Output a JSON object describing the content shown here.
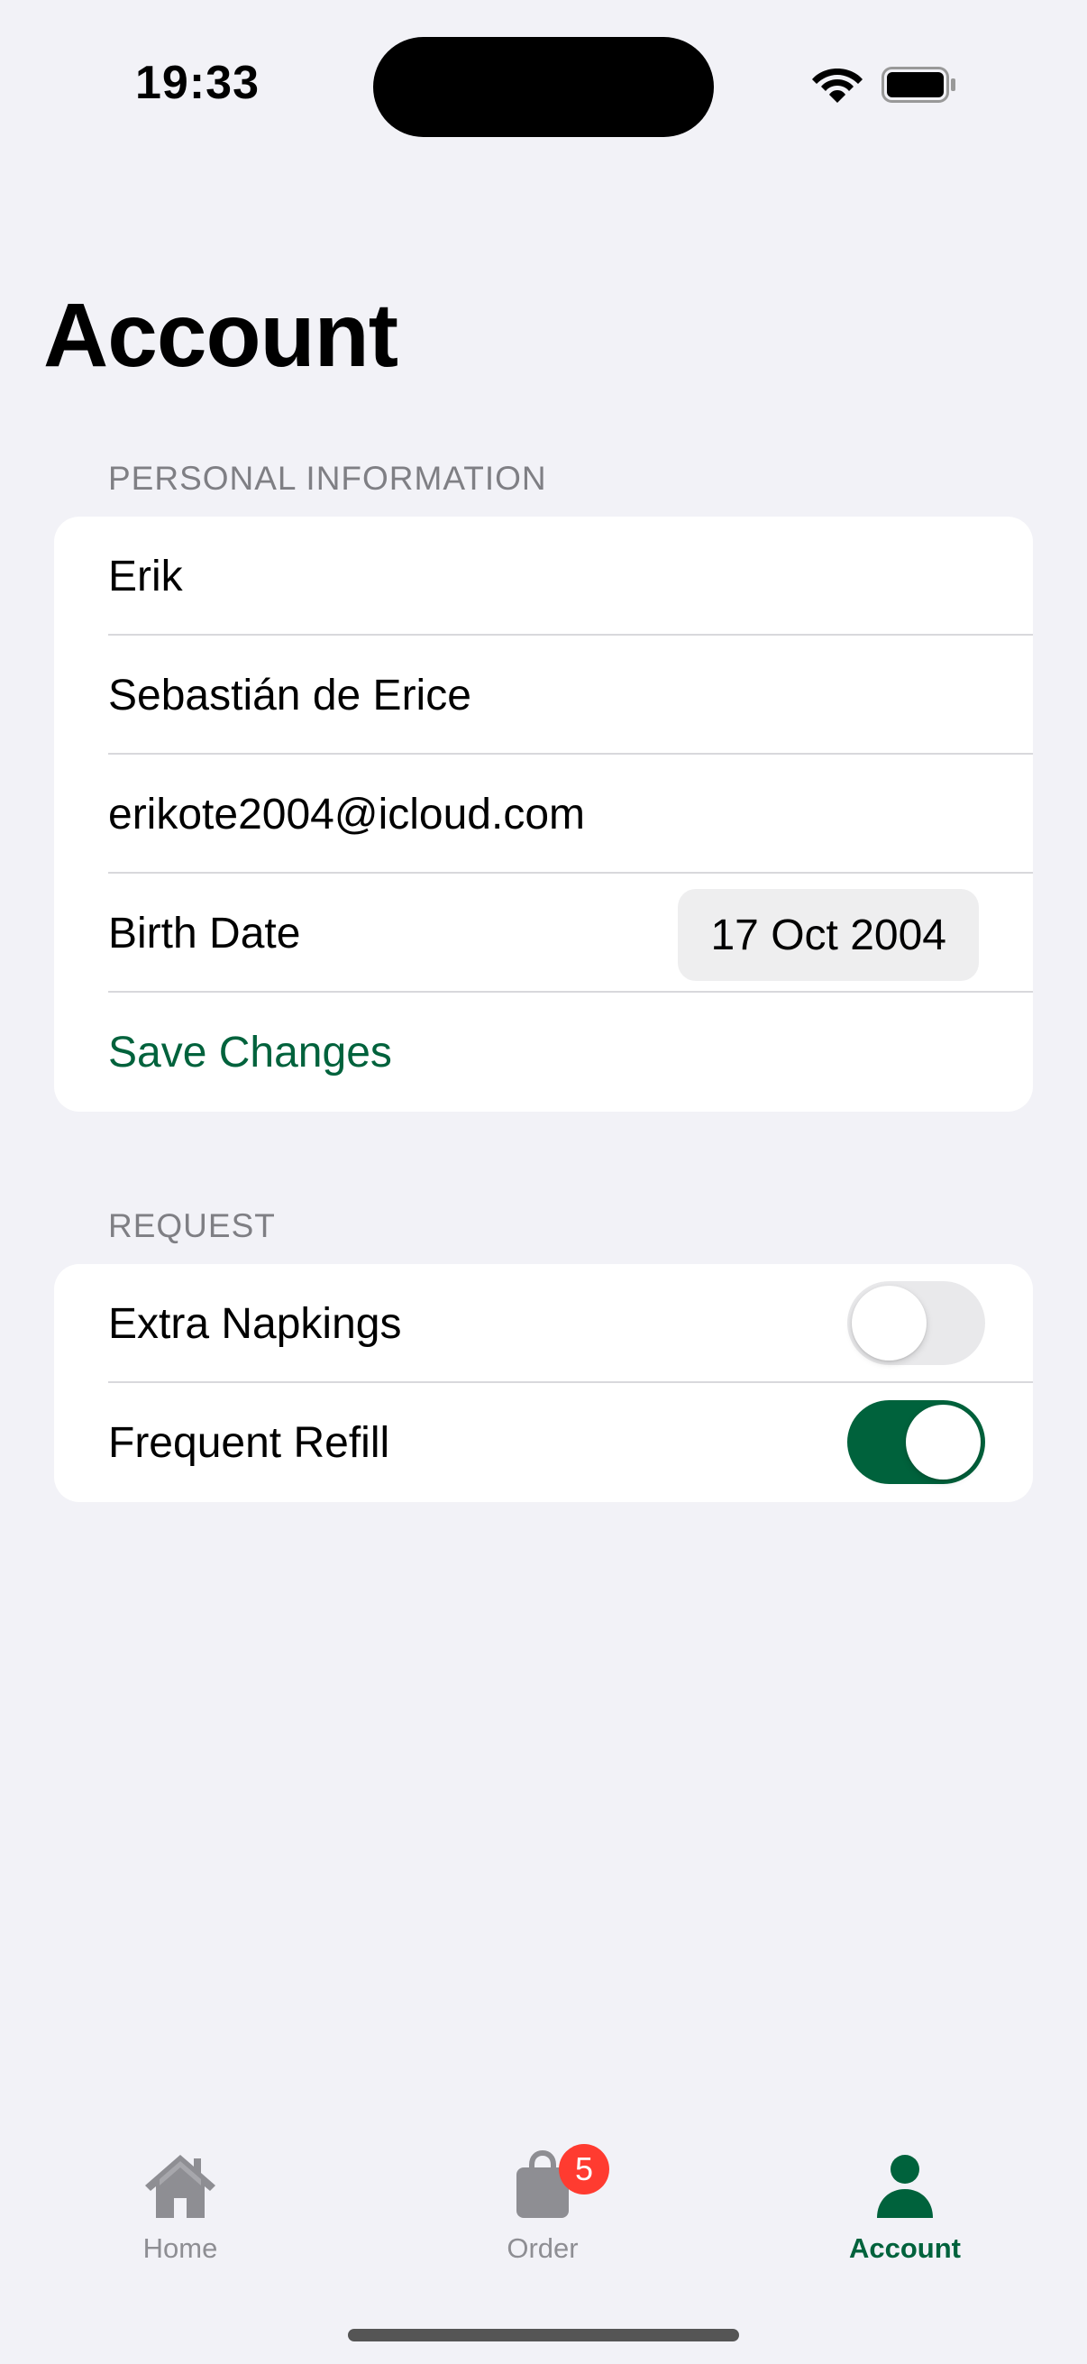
{
  "status_bar": {
    "time": "19:33"
  },
  "page": {
    "title": "Account"
  },
  "personal_information": {
    "header": "PERSONAL INFORMATION",
    "first_name": "Erik",
    "last_name": "Sebastián de Erice",
    "email": "erikote2004@icloud.com",
    "birth_date_label": "Birth Date",
    "birth_date_value": "17 Oct 2004",
    "save_label": "Save Changes"
  },
  "request": {
    "header": "REQUEST",
    "items": [
      {
        "label": "Extra Napkings",
        "enabled": false
      },
      {
        "label": "Frequent Refill",
        "enabled": true
      }
    ]
  },
  "tab_bar": {
    "tabs": [
      {
        "label": "Home",
        "icon": "house-icon",
        "active": false
      },
      {
        "label": "Order",
        "icon": "bag-icon",
        "active": false,
        "badge": "5"
      },
      {
        "label": "Account",
        "icon": "person-icon",
        "active": true
      }
    ]
  },
  "colors": {
    "accent": "#00623C",
    "background": "#F2F2F7",
    "badge": "#FF3B30",
    "inactive_tab": "#8E8E93"
  }
}
